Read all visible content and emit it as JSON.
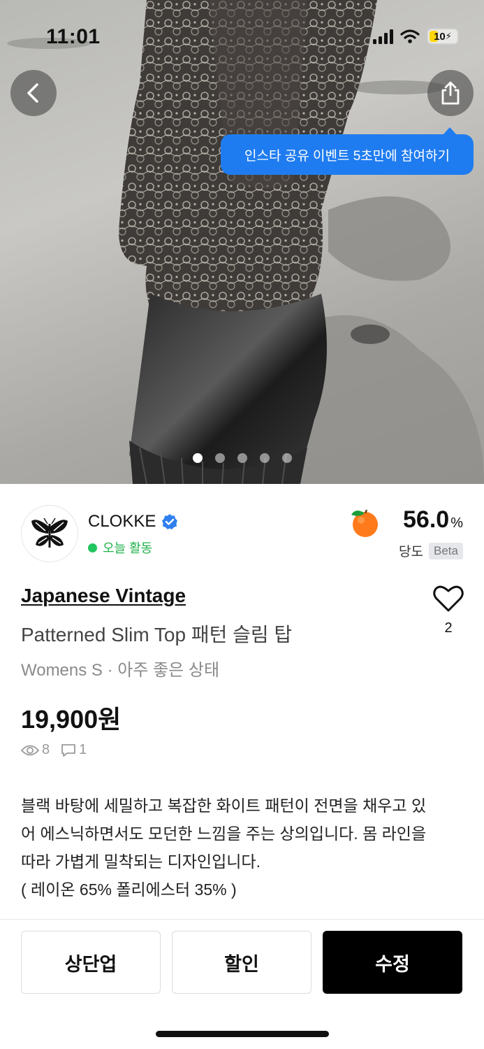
{
  "status_bar": {
    "time": "11:01",
    "battery": "10"
  },
  "hero": {
    "tooltip": "인스타 공유 이벤트 5초만에 참여하기",
    "image_count": 5,
    "current_image": 1
  },
  "seller": {
    "name": "CLOKKE",
    "activity": "오늘 활동"
  },
  "score": {
    "value": "56.0",
    "unit": "%",
    "label": "당도",
    "badge": "Beta"
  },
  "product": {
    "brand": "Japanese Vintage",
    "title": "Patterned Slim Top 패턴 슬림 탑",
    "meta": "Womens S · 아주 좋은 상태",
    "price": "19,900원",
    "likes": "2",
    "views": "8",
    "comments": "1",
    "description": "블랙 바탕에 세밀하고 복잡한 화이트 패턴이 전면을 채우고 있\n어 에스닉하면서도 모던한 느낌을 주는 상의입니다. 몸 라인을\n따라 가볍게 밀착되는 디자인입니다.\n( 레이온 65% 폴리에스터 35% )"
  },
  "actions": {
    "bump": "상단업",
    "discount": "할인",
    "edit": "수정"
  },
  "colors": {
    "tooltip_bg": "#1f7cf0",
    "online": "#22c55e",
    "primary_button": "#000000"
  }
}
